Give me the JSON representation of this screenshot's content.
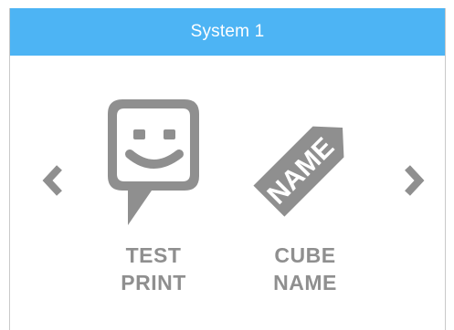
{
  "header": {
    "title": "System 1"
  },
  "navigation": {
    "prev_icon": "chevron-left-icon",
    "next_icon": "chevron-right-icon"
  },
  "menu_items": [
    {
      "icon": "smiley-speech-bubble-icon",
      "label_line1": "TEST",
      "label_line2": "PRINT"
    },
    {
      "icon": "name-tag-icon",
      "icon_text": "NAME",
      "label_line1": "CUBE",
      "label_line2": "NAME"
    }
  ],
  "colors": {
    "header_bg": "#4db4f4",
    "header_text": "#ffffff",
    "icon_gray": "#8f8f8f",
    "label_gray": "#8f8f8f",
    "background": "#ffffff"
  }
}
